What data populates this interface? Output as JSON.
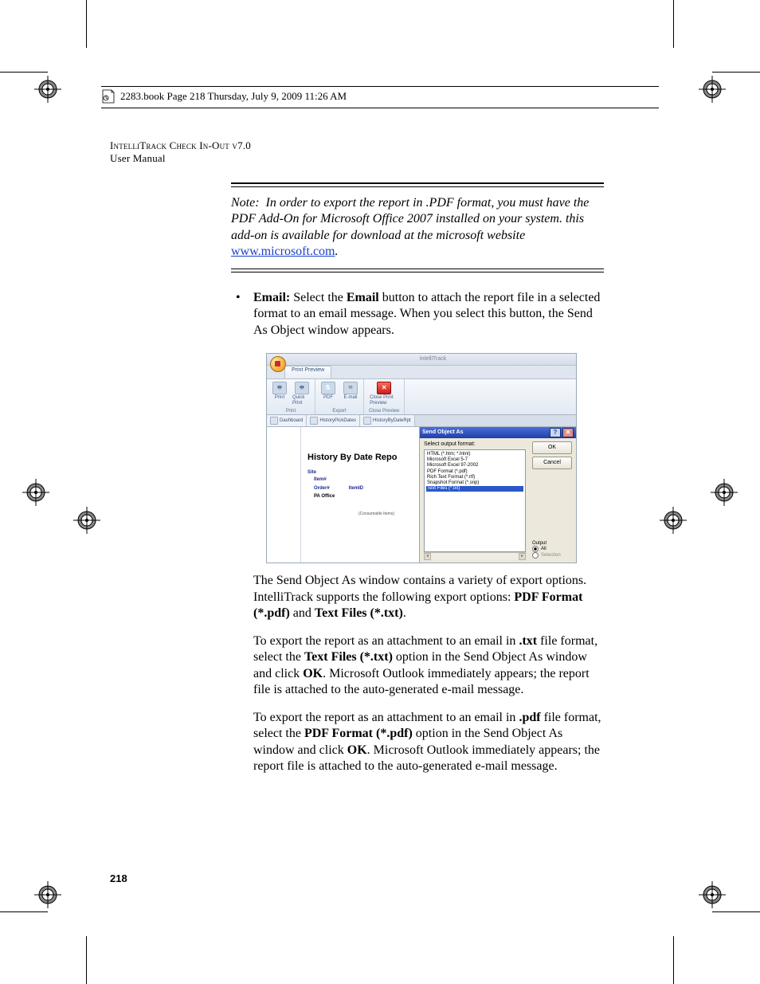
{
  "page_info_line": "2283.book  Page 218  Thursday, July 9, 2009  11:26 AM",
  "running_head": {
    "line1": "IntelliTrack Check In-Out v7.0",
    "line2": "User Manual"
  },
  "note": {
    "prefix": "Note:",
    "text1": "In order to export the report in .PDF format, you must have the PDF Add-On for Microsoft Office 2007 installed on your system. this add-on is available for download at the microsoft website ",
    "link_text": "www.microsoft.com",
    "trail": "."
  },
  "bullet": {
    "label": "Email:",
    "text": " Select the Email button to attach the report file in a selected format to an email message. When you select this button, the Send As Object window appears.",
    "email_word": "Email"
  },
  "para_after_image": {
    "t1": "The Send Object As window contains a variety of export options. IntelliTrack supports the following export options: ",
    "b1": "PDF Format (*.pdf)",
    "mid": " and ",
    "b2": "Text Files (*.txt)",
    "end": "."
  },
  "para_txt": {
    "t1": "To export the report as an attachment to an email in ",
    "b1": ".txt",
    "t2": " file format, select the ",
    "b2": "Text Files (*.txt)",
    "t3": " option in the Send Object As window and click ",
    "b3": "OK",
    "t4": ". Microsoft Outlook immediately appears; the report file is attached to the auto-generated e-mail message."
  },
  "para_pdf": {
    "t1": "To export the report as an attachment to an email in ",
    "b1": ".pdf",
    "t2": " file format, select the ",
    "b2": "PDF Format (*.pdf)",
    "t3": " option in the Send Object As window and click ",
    "b3": "OK",
    "t4": ". Microsoft Outlook immediately appears; the report file is attached to the auto-generated e-mail message."
  },
  "page_number": "218",
  "app": {
    "title_right": "IntelliTrack",
    "tab": "Print Preview",
    "ribbon": {
      "print_group": "Print",
      "export_group": "Export",
      "close_group": "Close Preview",
      "btn_print": "Print",
      "btn_quick": "Quick Print",
      "btn_pdf": "PDF",
      "btn_email": "E-mail",
      "btn_close": "Close Print Preview"
    },
    "doctabs": {
      "t1": "Dashboard",
      "t2": "HistoryPickDates",
      "t3": "HistoryByDateRpt"
    },
    "report": {
      "title": "History By Date Repo",
      "site": "Site",
      "item_num": "Item#",
      "order_num": "Order#",
      "itemid": "ItemID",
      "site_value": "PA Office",
      "footer_note": "(Consumable Items)"
    },
    "dialog": {
      "title": "Send Object As",
      "label": "Select output format:",
      "options": [
        "HTML (*.htm; *.html)",
        "Microsoft Excel 5-7",
        "Microsoft Excel 97-2002",
        "PDF Format (*.pdf)",
        "Rich Text Format (*.rtf)",
        "Snapshot Format (*.snp)",
        "Text Files (*.txt)"
      ],
      "selected": "Text Files (*.txt)",
      "ok": "OK",
      "cancel": "Cancel",
      "output_label": "Output",
      "radio_all": "All",
      "radio_sel": "Selection"
    }
  }
}
